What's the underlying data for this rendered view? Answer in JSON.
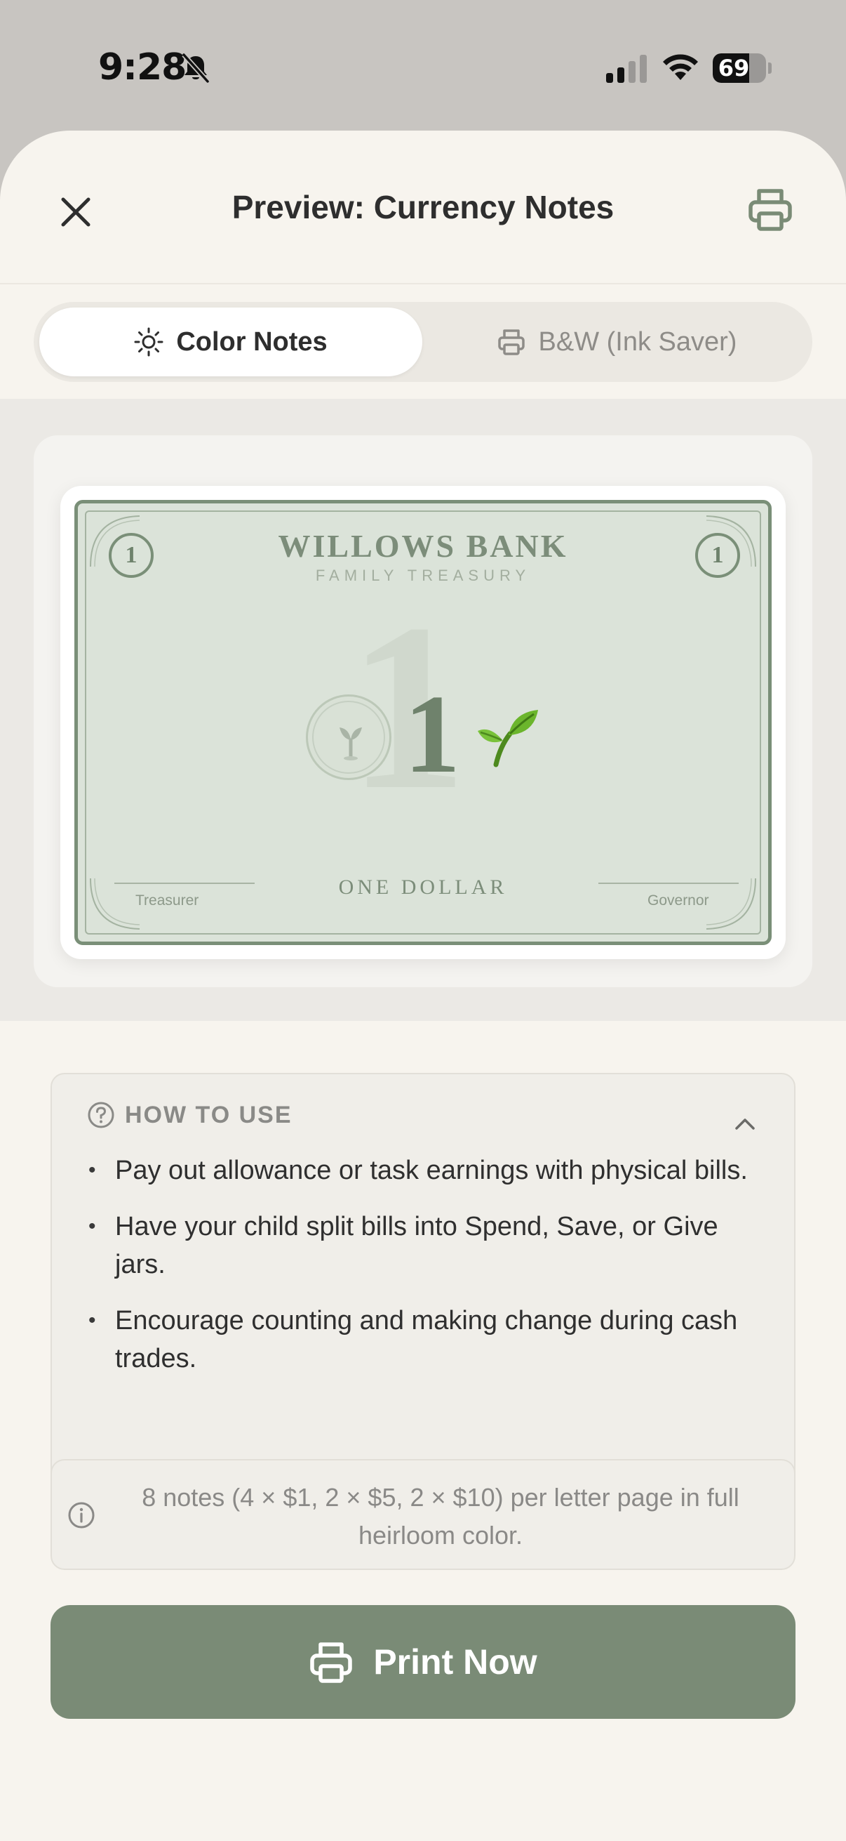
{
  "status_bar": {
    "time": "9:28",
    "battery": "69",
    "battery_level": 0.69
  },
  "header": {
    "title": "Preview: Currency Notes",
    "close_icon": "close-icon",
    "print_icon": "printer-icon"
  },
  "segmented": {
    "color_label": "Color Notes",
    "bw_label": "B&W (Ink Saver)",
    "selected": "Color Notes"
  },
  "note": {
    "bank_name": "WILLOWS BANK",
    "subtitle": "FAMILY TREASURY",
    "corner_value": "1",
    "big_value": "1",
    "value": "1",
    "denomination": "ONE DOLLAR",
    "treasurer_label": "Treasurer",
    "governor_label": "Governor",
    "emoji": "🌱"
  },
  "howto": {
    "title": "HOW TO USE",
    "items": [
      "Pay out allowance or task earnings with physical bills.",
      "Have your child split bills into Spend, Save, or Give jars.",
      "Encourage counting and making change during cash trades."
    ]
  },
  "info": {
    "text": "8 notes (4 × $1, 2 × $5, 2 × $10) per letter page in full heirloom color."
  },
  "print_button": {
    "label": "Print Now"
  },
  "colors": {
    "accent": "#7a8b76",
    "note_bg": "#dbe3d9",
    "sheet_bg": "#f7f4ee"
  }
}
